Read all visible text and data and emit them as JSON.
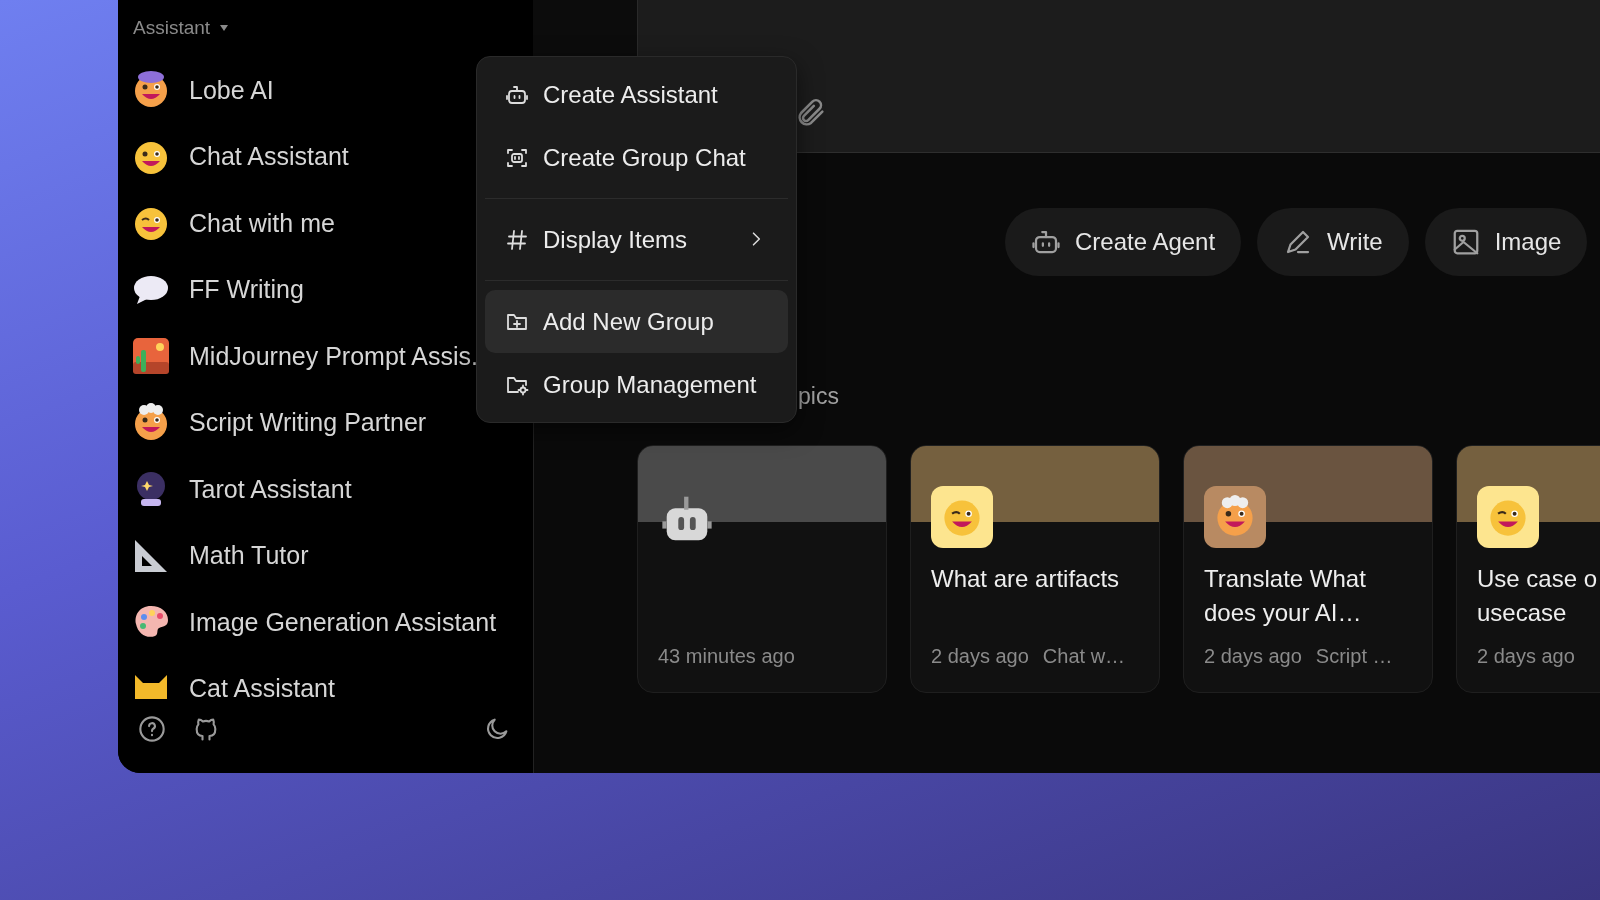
{
  "sidebar": {
    "header": "Assistant",
    "items": [
      {
        "name": "Lobe AI"
      },
      {
        "name": "Chat Assistant"
      },
      {
        "name": "Chat with me"
      },
      {
        "name": "FF Writing"
      },
      {
        "name": "MidJourney Prompt Assis."
      },
      {
        "name": "Script Writing Partner"
      },
      {
        "name": "Tarot Assistant"
      },
      {
        "name": "Math Tutor"
      },
      {
        "name": "Image Generation Assistant"
      },
      {
        "name": "Cat Assistant"
      }
    ]
  },
  "context_menu": {
    "groups": [
      {
        "items": [
          {
            "label": "Create Assistant",
            "selected": false,
            "has_submenu": false
          },
          {
            "label": "Create Group Chat",
            "selected": false,
            "has_submenu": false
          }
        ]
      },
      {
        "items": [
          {
            "label": "Display Items",
            "selected": false,
            "has_submenu": true
          }
        ]
      },
      {
        "items": [
          {
            "label": "Add New Group",
            "selected": true,
            "has_submenu": false
          },
          {
            "label": "Group Management",
            "selected": false,
            "has_submenu": false
          }
        ]
      }
    ]
  },
  "suggestions": [
    {
      "label": "Create Agent"
    },
    {
      "label": "Write"
    },
    {
      "label": "Image"
    }
  ],
  "topics_heading": "pics",
  "topic_cards": [
    {
      "color": "#4a4a4a",
      "time": "43 minutes ago"
    },
    {
      "color": "#75603f",
      "title": "What are artifacts",
      "time": "2 days ago",
      "assistant": "Chat w…"
    },
    {
      "color": "#6a5440",
      "title": "Translate What does your AI…",
      "time": "2 days ago",
      "assistant": "Script …"
    },
    {
      "color": "#75603f",
      "title": "Use case o\nusecase",
      "time": "2 days ago"
    }
  ]
}
